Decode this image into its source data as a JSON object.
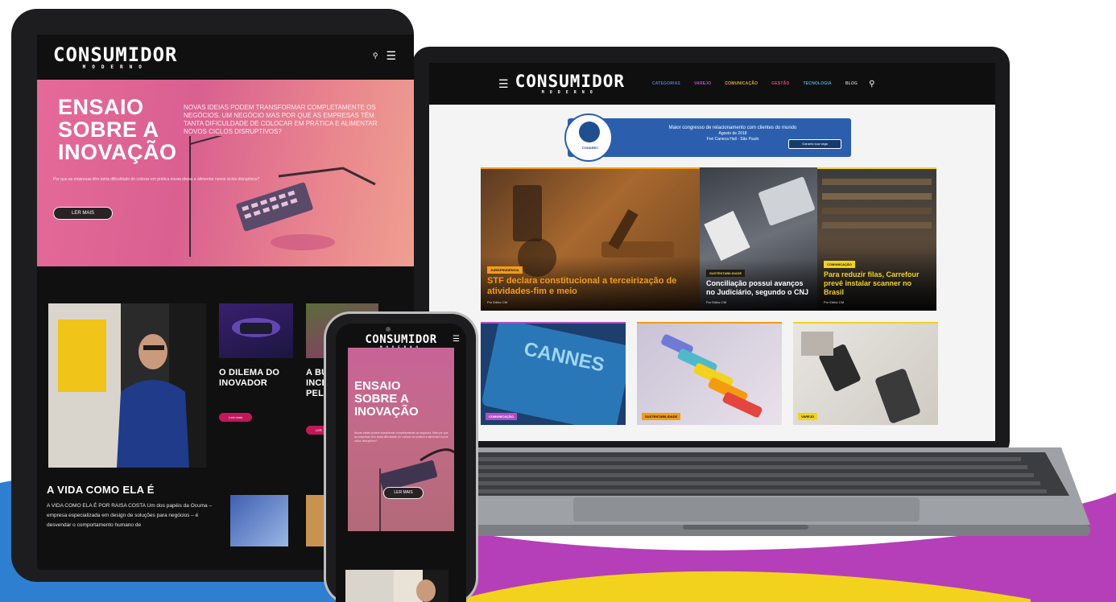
{
  "brand": {
    "logo_text": "CONSUMIDOR",
    "logo_sub": "MODERNO"
  },
  "colors": {
    "wave_blue": "#2f7fd0",
    "wave_purple": "#b53fb8",
    "wave_yellow": "#f3d21e",
    "hero_pink": "#e56a9a",
    "accent_magenta": "#c2185b",
    "tag_orange": "#f39c12",
    "tag_yellow": "#f3d21e",
    "tag_purple": "#b04fc6"
  },
  "laptop": {
    "menu_items": [
      {
        "label": "CATEGORIAS",
        "color": "#4a7bd6"
      },
      {
        "label": "VAREJO",
        "color": "#c04cd0"
      },
      {
        "label": "COMUNICAÇÃO",
        "color": "#e5a92a"
      },
      {
        "label": "GESTÃO",
        "color": "#e54a6a"
      },
      {
        "label": "TECNOLOGIA",
        "color": "#3fb8d6"
      },
      {
        "label": "BLOG",
        "color": "#bbbbbb"
      }
    ],
    "ad": {
      "badge": "CONAREC",
      "headline": "Maior congresso de relacionamento com clientes do mundo",
      "dates": "Agosto de 2018",
      "location": "Frei Caneca Hall - São Paulo",
      "cta": "Garanta sua vaga"
    },
    "cards": [
      {
        "tag": "JURISPRUDÊNCIA",
        "title": "STF declara constitucional a terceirização de atividades-fim e meio",
        "byline": "Por Editor CM"
      },
      {
        "tag": "SUSTENTABILIDADE",
        "title": "Conciliação possui avanços no Judiciário, segundo o CNJ",
        "byline": "Por Editor CM"
      },
      {
        "tag": "COMUNICAÇÃO",
        "title": "Para reduzir filas, Carrefour prevê instalar scanner no Brasil",
        "byline": "Por Editor CM"
      },
      {
        "tag": "COMUNICAÇÃO"
      },
      {
        "tag": "SUSTENTABILIDADE"
      },
      {
        "tag": "VAREJO"
      }
    ]
  },
  "tablet": {
    "hero": {
      "title_line1": "ENSAIO",
      "title_line2": "SOBRE A",
      "title_line3": "INOVAÇÃO",
      "lead": "NOVAS IDEIAS PODEM TRANSFORMAR COMPLETAMENTE OS NEGÓCIOS. UM NEGÓCIO MAS POR QUE AS EMPRESAS TÊM TANTA DIFICULDADE DE COLOCAR EM PRÁTICA E ALIMENTAR NOVOS CICLOS DISRUPTIVOS?",
      "body": "Por que as empresas têm tanta dificuldade de colocar em prática novas ideias e alimentar novos ciclos disruptivos?",
      "button": "LER MAIS"
    },
    "feature": {
      "title": "A VIDA COMO ELA É",
      "text": "A VIDA COMO ELA É POR RAISA COSTA Um dos papéis da Ocuma – empresa especializada em design de soluções para negócios – é desvendar o comportamento humano de"
    },
    "cards": [
      {
        "title_l1": "O DILEMA DO",
        "title_l2": "INOVADOR",
        "button": "Leia mais"
      },
      {
        "title_l1": "A BUS",
        "title_l2": "INCES",
        "title_l3": "PELA I",
        "button": "LER"
      }
    ]
  },
  "phone": {
    "hero": {
      "title_line1": "ENSAIO",
      "title_line2": "SOBRE A",
      "title_line3": "INOVAÇÃO",
      "body": "Novas ideias podem transformar completamente os negócios. Mas por que as empresas têm tanta dificuldade de colocar em prática e alimentar novos ciclos disruptivos?",
      "button": "LER MAIS"
    }
  },
  "icons": {
    "search": "search-icon",
    "menu": "menu-icon"
  }
}
